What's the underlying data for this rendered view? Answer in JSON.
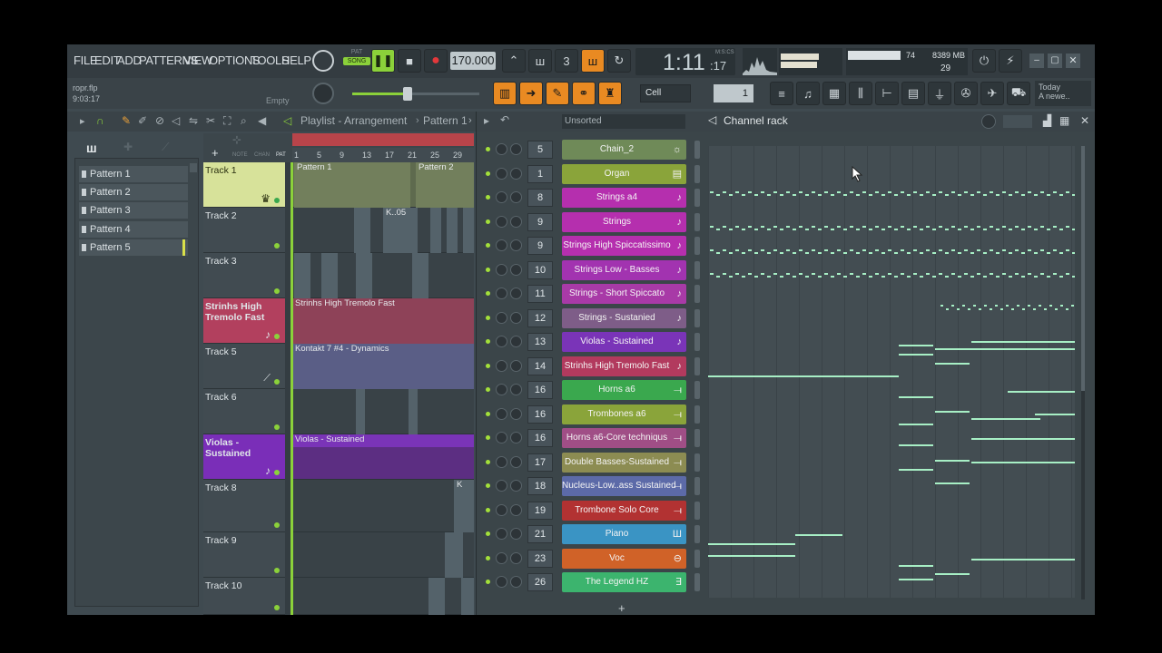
{
  "menu": [
    "FILE",
    "EDIT",
    "ADD",
    "PATTERNS",
    "VIEW",
    "OPTIONS",
    "TOOLS",
    "HELP"
  ],
  "transport": {
    "mode_top": "PAT",
    "mode": "SONG",
    "tempo": "170.000",
    "time": "1:11",
    "time_small": ":17",
    "time_unit": "M:S:CS"
  },
  "monitor": {
    "mem": "8389 MB",
    "cpu_top": "74",
    "cpu": "29"
  },
  "project": {
    "file": "ropr.flp",
    "time": "9:03:17",
    "hint": "Empty"
  },
  "snap": {
    "label": "Cell",
    "step": "1"
  },
  "news": {
    "line1": "Today",
    "line2": "A newe.."
  },
  "playlist": {
    "title": "Playlist - Arrangement",
    "crumb": "Pattern 1",
    "ruler": [
      "1",
      "5",
      "9",
      "13",
      "17",
      "21",
      "25",
      "29"
    ],
    "hdr_labels": [
      "NOTE",
      "CHAN",
      "PAT"
    ]
  },
  "patterns": [
    "Pattern 1",
    "Pattern 2",
    "Pattern 3",
    "Pattern 4",
    "Pattern 5"
  ],
  "tracks": [
    {
      "name": "Track 1",
      "clips": [
        "Pattern 1",
        "Pattern 2"
      ]
    },
    {
      "name": "Track 2",
      "clips": [
        "K..05"
      ]
    },
    {
      "name": "Track 3",
      "clips": []
    },
    {
      "name": "Strinhs High Tremolo Fast",
      "clips": [
        "Strinhs High Tremolo Fast"
      ]
    },
    {
      "name": "Track 5",
      "clips": [
        "Kontakt 7 #4 - Dynamics"
      ]
    },
    {
      "name": "Track 6",
      "clips": []
    },
    {
      "name": "Violas - Sustained",
      "clips": [
        "Violas - Sustained"
      ]
    },
    {
      "name": "Track 8",
      "clips": [
        "K"
      ]
    },
    {
      "name": "Track 9",
      "clips": []
    },
    {
      "name": "Track 10",
      "clips": []
    }
  ],
  "rack": {
    "filter": "Unsorted",
    "title": "Channel rack"
  },
  "channels": [
    {
      "num": "5",
      "name": "Chain_2",
      "color": "#6f8a58",
      "icon": "☼"
    },
    {
      "num": "1",
      "name": "Organ",
      "color": "#8aa43a",
      "icon": "▤"
    },
    {
      "num": "8",
      "name": "Strings a4",
      "color": "#b52fae",
      "icon": "♪"
    },
    {
      "num": "9",
      "name": "Strings",
      "color": "#b52fae",
      "icon": "♪"
    },
    {
      "num": "9",
      "name": "Strings High Spiccatissimo",
      "color": "#b52fae",
      "icon": "♪"
    },
    {
      "num": "10",
      "name": "Strings Low - Basses",
      "color": "#a233b0",
      "icon": "♪"
    },
    {
      "num": "11",
      "name": "Strings - Short Spiccato",
      "color": "#a83aa7",
      "icon": "♪"
    },
    {
      "num": "12",
      "name": "Strings - Sustanied",
      "color": "#7e5d88",
      "icon": "♪"
    },
    {
      "num": "13",
      "name": "Violas - Sustained",
      "color": "#7a34b8",
      "icon": "♪"
    },
    {
      "num": "14",
      "name": "Strinhs High Tremolo Fast",
      "color": "#b23a5e",
      "icon": "♪"
    },
    {
      "num": "16",
      "name": "Horns a6",
      "color": "#3aa84e",
      "icon": "⟞"
    },
    {
      "num": "16",
      "name": "Trombones a6",
      "color": "#8aa43a",
      "icon": "⟞"
    },
    {
      "num": "16",
      "name": "Horns a6-Core techniqus",
      "color": "#a04e86",
      "icon": "⟞"
    },
    {
      "num": "17",
      "name": "Double Basses-Sustained",
      "color": "#8c8c52",
      "icon": "⟞"
    },
    {
      "num": "18",
      "name": "Nucleus-Low..ass Sustained",
      "color": "#5c6aa8",
      "icon": "⟞"
    },
    {
      "num": "19",
      "name": "Trombone Solo Core",
      "color": "#b23232",
      "icon": "⟞"
    },
    {
      "num": "21",
      "name": "Piano",
      "color": "#3a94c4",
      "icon": "Ш"
    },
    {
      "num": "23",
      "name": "Voc",
      "color": "#d06228",
      "icon": "⊖"
    },
    {
      "num": "26",
      "name": "The Legend HZ",
      "color": "#3cb46e",
      "icon": "∃"
    }
  ],
  "colors": {
    "accent": "#e98a22",
    "rack_bg": "#3b4549"
  }
}
